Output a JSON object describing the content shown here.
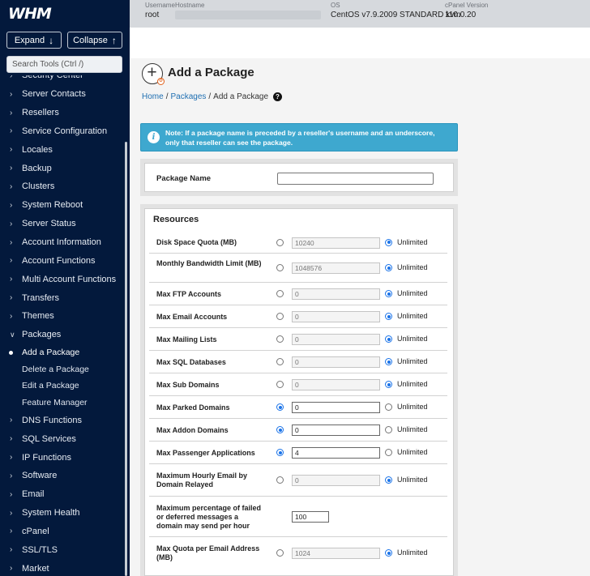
{
  "sidebar": {
    "logo": "WHM",
    "expand_label": "Expand",
    "collapse_label": "Collapse",
    "search_placeholder": "Search Tools (Ctrl /)",
    "items": [
      "Security Center",
      "Server Contacts",
      "Resellers",
      "Service Configuration",
      "Locales",
      "Backup",
      "Clusters",
      "System Reboot",
      "Server Status",
      "Account Information",
      "Account Functions",
      "Multi Account Functions",
      "Transfers",
      "Themes",
      "Packages"
    ],
    "packages_sub": [
      "Add a Package",
      "Delete a Package",
      "Edit a Package",
      "Feature Manager"
    ],
    "items_after": [
      "DNS Functions",
      "SQL Services",
      "IP Functions",
      "Software",
      "Email",
      "System Health",
      "cPanel",
      "SSL/TLS",
      "Market"
    ]
  },
  "topbar": {
    "username_label": "Username",
    "username": "root",
    "hostname_label": "Hostname",
    "os_label": "OS",
    "os": "CentOS v7.9.2009 STANDARD kvm",
    "cpanel_label": "cPanel Version",
    "cpanel_version": "110.0.20"
  },
  "page": {
    "title": "Add a Package",
    "breadcrumb": {
      "home": "Home",
      "packages": "Packages",
      "current": "Add a Package"
    },
    "note": "Note: If a package name is preceded by a reseller's username and an underscore, only that reseller can see the package.",
    "package_name_label": "Package Name",
    "resources_title": "Resources",
    "unlimited_label": "Unlimited"
  },
  "resources": [
    {
      "label": "Disk Space Quota (MB)",
      "value": "10240",
      "mode": "unlimited"
    },
    {
      "label": "Monthly Bandwidth Limit (MB)",
      "value": "1048576",
      "mode": "unlimited"
    },
    {
      "label": "Max FTP Accounts",
      "value": "0",
      "mode": "unlimited"
    },
    {
      "label": "Max Email Accounts",
      "value": "0",
      "mode": "unlimited"
    },
    {
      "label": "Max Mailing Lists",
      "value": "0",
      "mode": "unlimited"
    },
    {
      "label": "Max SQL Databases",
      "value": "0",
      "mode": "unlimited"
    },
    {
      "label": "Max Sub Domains",
      "value": "0",
      "mode": "unlimited"
    },
    {
      "label": "Max Parked Domains",
      "value": "0",
      "mode": "custom"
    },
    {
      "label": "Max Addon Domains",
      "value": "0",
      "mode": "custom"
    },
    {
      "label": "Max Passenger Applications",
      "value": "4",
      "mode": "custom"
    },
    {
      "label": "Maximum Hourly Email by Domain Relayed",
      "value": "0",
      "mode": "unlimited"
    },
    {
      "label": "Maximum percentage of failed or deferred messages a domain may send per hour",
      "value": "100",
      "mode": "input-only"
    },
    {
      "label": "Max Quota per Email Address (MB)",
      "value": "1024",
      "mode": "unlimited"
    }
  ]
}
